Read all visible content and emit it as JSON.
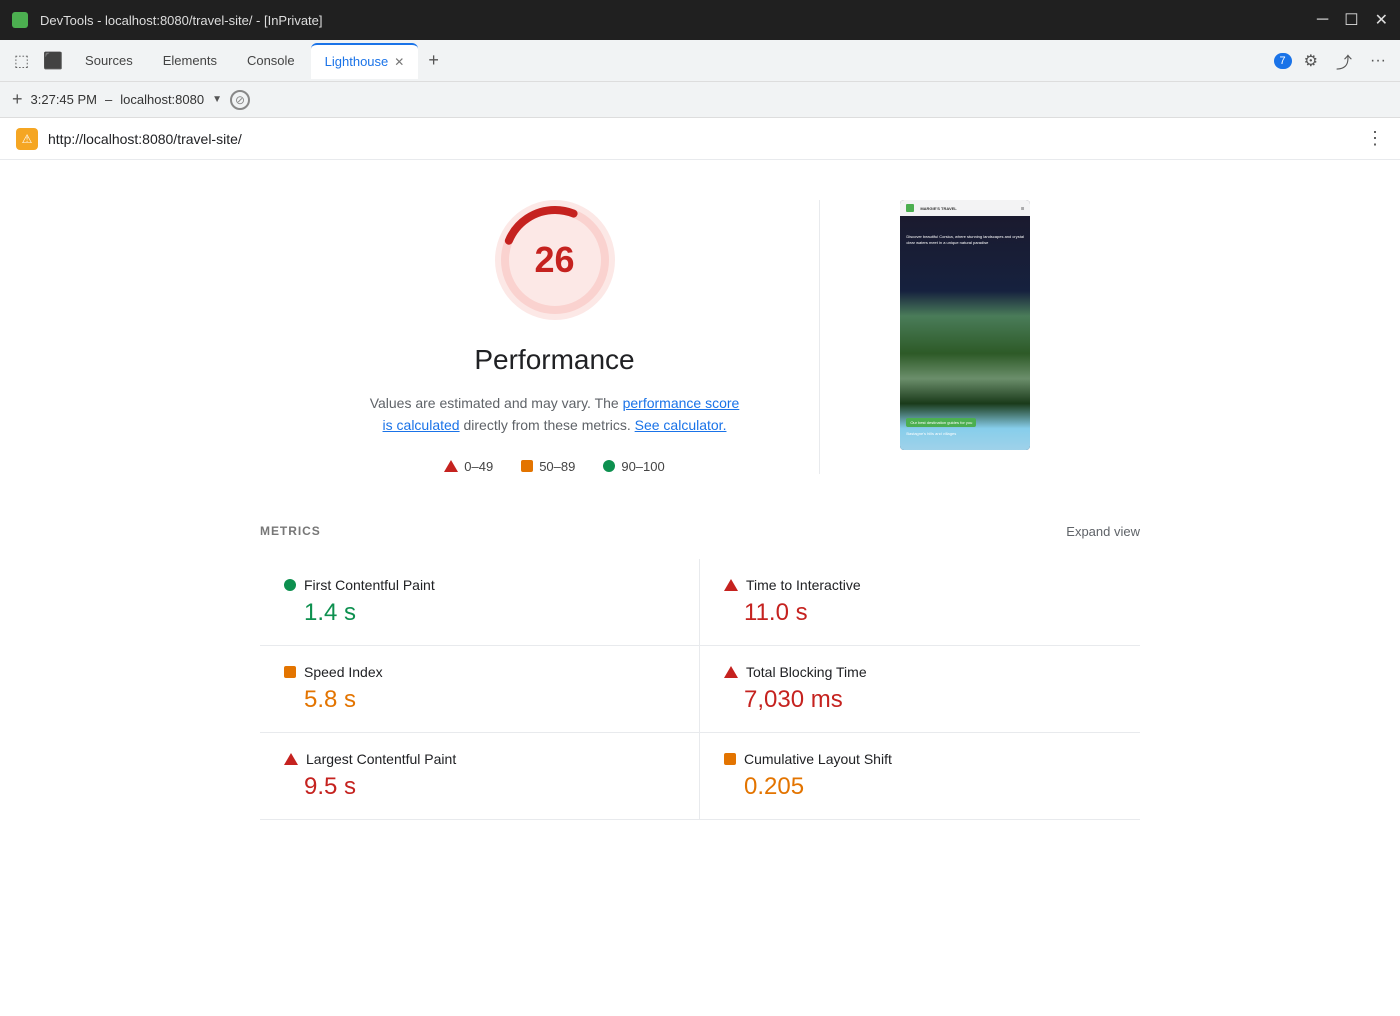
{
  "titleBar": {
    "icon": "devtools-icon",
    "title": "DevTools - localhost:8080/travel-site/ - [InPrivate]",
    "controls": [
      "minimize",
      "restore",
      "close"
    ]
  },
  "tabs": {
    "items": [
      {
        "label": "Sources",
        "active": false
      },
      {
        "label": "Elements",
        "active": false
      },
      {
        "label": "Console",
        "active": false
      },
      {
        "label": "Lighthouse",
        "active": true
      }
    ],
    "addTab": "+",
    "badgeCount": "7"
  },
  "addressBar": {
    "plus": "+",
    "time": "3:27:45 PM",
    "separator": "–",
    "host": "localhost:8080",
    "dropdown": "▼",
    "blockSymbol": "⊘"
  },
  "urlBar": {
    "url": "http://localhost:8080/travel-site/",
    "menuDots": "⋮"
  },
  "lighthouse": {
    "score": "26",
    "title": "Performance",
    "description": "Values are estimated and may vary. The",
    "descLink1": "performance score\nis calculated",
    "descMiddle": "directly from these metrics.",
    "descLink2": "See calculator.",
    "legend": [
      {
        "type": "triangle",
        "range": "0–49"
      },
      {
        "type": "square",
        "range": "50–89"
      },
      {
        "type": "circle",
        "range": "90–100"
      }
    ]
  },
  "preview": {
    "siteTitle": "MARGIE'S TRAVEL",
    "heroText": "Discover beautiful Corsica, where stunning landscapes and crystal clear waters meet in a unique natural paradise",
    "btnText": "Our best destination guides for you",
    "bottomText": "Bastagne's hills and villages"
  },
  "metrics": {
    "label": "METRICS",
    "expandView": "Expand view",
    "items": [
      {
        "name": "First Contentful Paint",
        "value": "1.4 s",
        "status": "green",
        "indicator": "green"
      },
      {
        "name": "Time to Interactive",
        "value": "11.0 s",
        "status": "red",
        "indicator": "red"
      },
      {
        "name": "Speed Index",
        "value": "5.8 s",
        "status": "orange",
        "indicator": "orange"
      },
      {
        "name": "Total Blocking Time",
        "value": "7,030 ms",
        "status": "red",
        "indicator": "red"
      },
      {
        "name": "Largest Contentful Paint",
        "value": "9.5 s",
        "status": "red",
        "indicator": "red"
      },
      {
        "name": "Cumulative Layout Shift",
        "value": "0.205",
        "status": "orange",
        "indicator": "orange"
      }
    ]
  }
}
